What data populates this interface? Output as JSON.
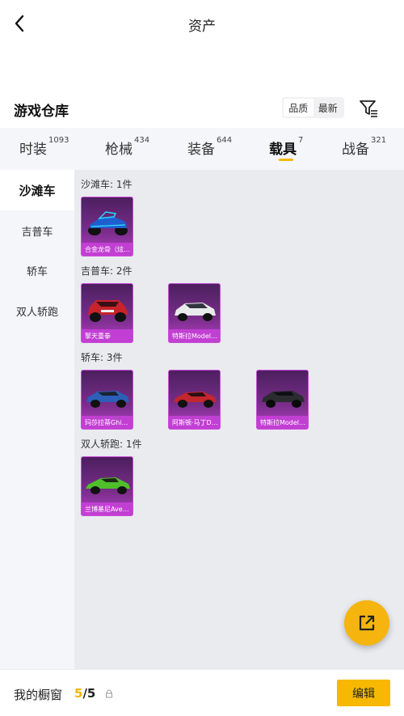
{
  "header": {
    "title": "资产"
  },
  "section": {
    "title": "游戏仓库",
    "sort_options": [
      "品质",
      "最新"
    ]
  },
  "tabs": [
    {
      "label": "时装",
      "count": "1093"
    },
    {
      "label": "枪械",
      "count": "434"
    },
    {
      "label": "装备",
      "count": "644"
    },
    {
      "label": "载具",
      "count": "7"
    },
    {
      "label": "战备",
      "count": "321"
    }
  ],
  "sidebar": {
    "items": [
      "沙滩车",
      "吉普车",
      "轿车",
      "双人轿跑"
    ]
  },
  "groups": [
    {
      "title": "沙滩车: 1件",
      "items": [
        {
          "name": "合金龙骨（炫…"
        }
      ]
    },
    {
      "title": "吉普车: 2件",
      "items": [
        {
          "name": "擎天重拳"
        },
        {
          "name": "特斯拉Model…"
        }
      ]
    },
    {
      "title": "轿车: 3件",
      "items": [
        {
          "name": "玛莎拉蒂Ghi…"
        },
        {
          "name": "阿斯顿·马丁D…"
        },
        {
          "name": "特斯拉Model…"
        }
      ]
    },
    {
      "title": "双人轿跑: 1件",
      "items": [
        {
          "name": "兰博基尼Ave…"
        }
      ]
    }
  ],
  "bottom": {
    "label": "我的橱窗",
    "current": "5",
    "total": "/5",
    "edit_label": "编辑"
  },
  "colors": {
    "accent": "#f6b800",
    "card": "#b23ec2"
  }
}
